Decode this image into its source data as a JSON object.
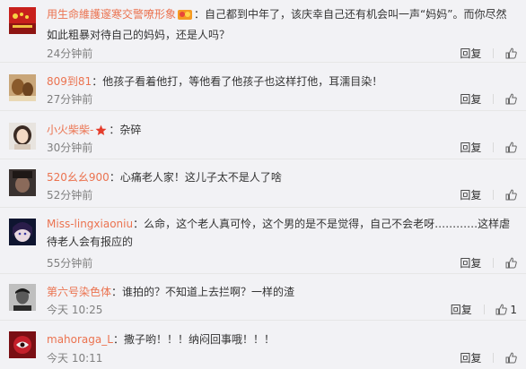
{
  "comments": [
    {
      "user": "用生命維護邃寒交警嘹形象",
      "text_parts": [
        "：自己都到中年了，该庆幸自己还有机会叫一声“妈妈”。而你尽然如此粗暴对待自己的妈妈，还是人吗？"
      ],
      "time": "24分钟前",
      "reply": "回复",
      "badge": "vip-badge-icon",
      "avatar": "flag-avatar"
    },
    {
      "user": "809到81",
      "text_parts": [
        "：他孩子看着他打，等他看了他孩子也这样打他，耳濡目染！"
      ],
      "time": "27分钟前",
      "reply": "回复",
      "avatar": "food-avatar"
    },
    {
      "user": "小火柴柴-",
      "text_parts": [
        "：杂碎"
      ],
      "time": "30分钟前",
      "reply": "回复",
      "badge": "star-icon",
      "avatar": "girl-avatar"
    },
    {
      "user": "520幺幺900",
      "text_parts": [
        "：心痛老人家！这儿子太不是人了啥"
      ],
      "time": "52分钟前",
      "reply": "回复",
      "avatar": "dark-avatar"
    },
    {
      "user": "Miss-lingxiaoniu",
      "text_parts": [
        "：么命，这个老人真可怜，这个男的是不是觉得，自己不会老呀…………这样虐待老人会有报应的"
      ],
      "time": "55分钟前",
      "reply": "回复",
      "avatar": "anime-avatar"
    },
    {
      "user": "第六号染色体",
      "text_parts": [
        "：谁拍的？不知道上去拦啊？一样的渣"
      ],
      "time": "今天 10:25",
      "reply": "回复",
      "like_count": "1",
      "avatar": "man-avatar"
    },
    {
      "user": "mahoraga_L",
      "text_parts": [
        "：撒子哟！！！纳闷回事哦！！！"
      ],
      "time": "今天 10:11",
      "reply": "回复",
      "avatar": "red-avatar"
    }
  ],
  "colors": {
    "username": "#eb7350",
    "text": "#333333",
    "time": "#808080",
    "background": "#f2f2f5",
    "divider": "#e6e6e6"
  }
}
